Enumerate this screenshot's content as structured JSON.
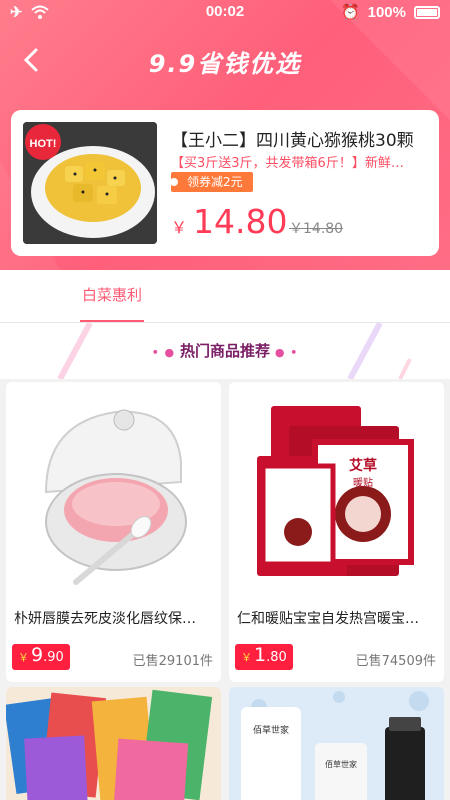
{
  "status_bar": {
    "time": "00:02",
    "battery": "100%"
  },
  "nav": {
    "title": "9.9省钱优选"
  },
  "deal": {
    "badge": "HOT!",
    "title": "【王小二】四川黄心猕猴桃30颗",
    "subtitle": "【买3斤送3斤，共发带箱6斤！】新鲜…",
    "coupon": "领券减2元",
    "currency": "￥",
    "price": "14.80",
    "original_price": "￥14.80"
  },
  "tabs": [
    {
      "label": "白菜惠利",
      "active": true
    }
  ],
  "section": {
    "title": "热门商品推荐"
  },
  "products": [
    {
      "title": "朴妍唇膜去死皮淡化唇纹保…",
      "price_int": "9",
      "price_dec": ".90",
      "currency": "￥",
      "sold": "已售29101件",
      "image": "lip-mask"
    },
    {
      "title": "仁和暖贴宝宝自发热宫暖宝…",
      "price_int": "1",
      "price_dec": ".80",
      "currency": "￥",
      "sold": "已售74509件",
      "image": "heat-patch",
      "brand_text": "艾草",
      "brand_sub": "暖贴"
    },
    {
      "image": "picture-books"
    },
    {
      "image": "skincare-bottles",
      "brand_text": "佰草世家"
    }
  ],
  "colors": {
    "accent": "#ff5a74",
    "price": "#ff3b55",
    "coupon": "#ff7a3a",
    "price_tag": "#ff1f3f"
  }
}
